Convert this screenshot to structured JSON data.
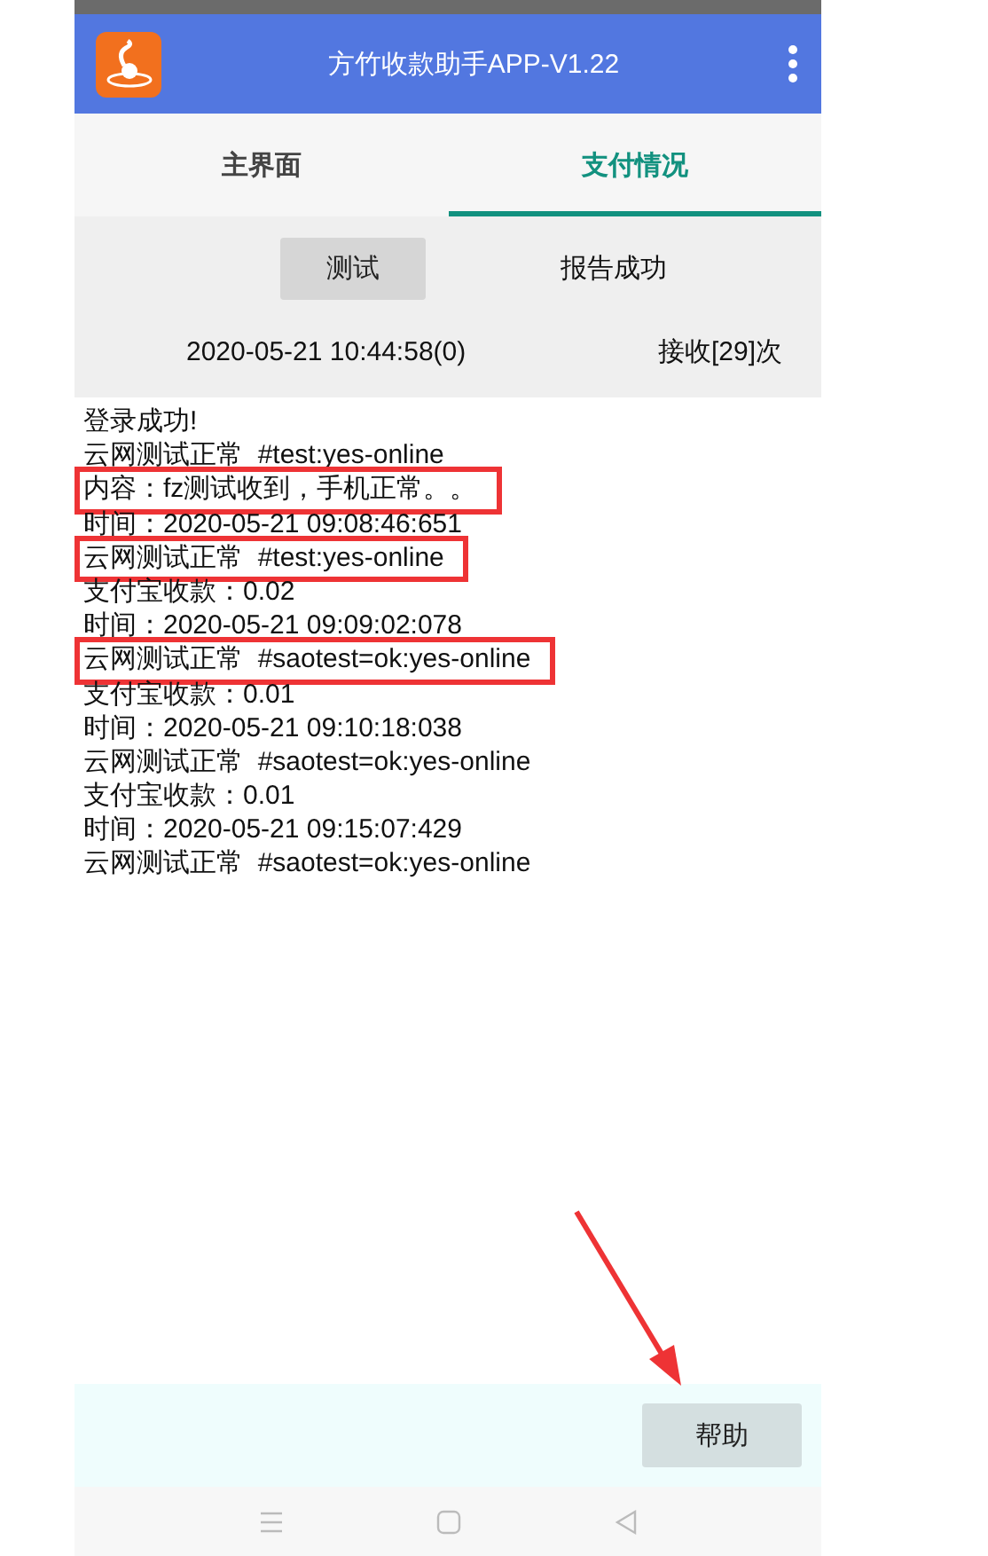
{
  "app_bar": {
    "title": "方竹收款助手APP-V1.22"
  },
  "tabs": [
    {
      "label": "主界面",
      "selected": false
    },
    {
      "label": "支付情况",
      "selected": true
    }
  ],
  "controls": {
    "test_button": "测试",
    "report_status": "报告成功",
    "timestamp": "2020-05-21 10:44:58(0)",
    "received_count": "接收[29]次"
  },
  "log": [
    {
      "text": "登录成功!",
      "highlighted": false
    },
    {
      "text": "云网测试正常  #test:yes-online",
      "highlighted": false
    },
    {
      "text": "内容：fz测试收到，手机正常。。",
      "highlighted": true
    },
    {
      "text": "时间：2020-05-21 09:08:46:651",
      "highlighted": false
    },
    {
      "text": "云网测试正常  #test:yes-online",
      "highlighted": true
    },
    {
      "text": "支付宝收款：0.02",
      "highlighted": false
    },
    {
      "text": "时间：2020-05-21 09:09:02:078",
      "highlighted": false
    },
    {
      "text": "云网测试正常  #saotest=ok:yes-online",
      "highlighted": true
    },
    {
      "text": "支付宝收款：0.01",
      "highlighted": false
    },
    {
      "text": "时间：2020-05-21 09:10:18:038",
      "highlighted": false
    },
    {
      "text": "云网测试正常  #saotest=ok:yes-online",
      "highlighted": false
    },
    {
      "text": "支付宝收款：0.01",
      "highlighted": false
    },
    {
      "text": "时间：2020-05-21 09:15:07:429",
      "highlighted": false
    },
    {
      "text": "云网测试正常  #saotest=ok:yes-online",
      "highlighted": false
    }
  ],
  "annotations": [
    {
      "kind": "arrow"
    }
  ],
  "footer": {
    "help_button": "帮助"
  }
}
